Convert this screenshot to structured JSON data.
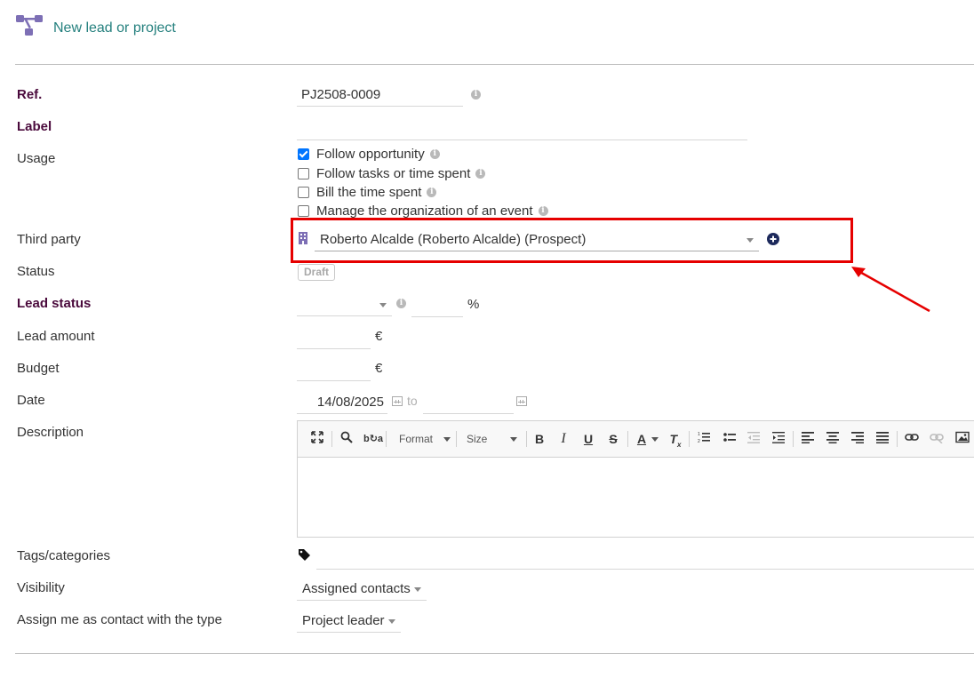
{
  "header": {
    "title": "New lead or project",
    "icon": "project-tree-icon"
  },
  "form": {
    "ref": {
      "label": "Ref.",
      "value": "PJ2508-0009"
    },
    "label_field": {
      "label": "Label",
      "value": ""
    },
    "usage": {
      "label": "Usage",
      "options": [
        {
          "label": "Follow opportunity",
          "checked": true
        },
        {
          "label": "Follow tasks or time spent",
          "checked": false
        },
        {
          "label": "Bill the time spent",
          "checked": false
        },
        {
          "label": "Manage the organization of an event",
          "checked": false
        }
      ]
    },
    "third_party": {
      "label": "Third party",
      "value": "Roberto Alcalde (Roberto Alcalde) (Prospect)"
    },
    "status": {
      "label": "Status",
      "value": "Draft"
    },
    "lead_status": {
      "label": "Lead status",
      "value": "",
      "percent_unit": "%"
    },
    "lead_amount": {
      "label": "Lead amount",
      "value": "",
      "currency": "€"
    },
    "budget": {
      "label": "Budget",
      "value": "",
      "currency": "€"
    },
    "date": {
      "label": "Date",
      "start": "14/08/2025",
      "to_label": "to",
      "end": ""
    },
    "description": {
      "label": "Description",
      "toolbar": {
        "format_label": "Format",
        "size_label": "Size"
      },
      "value": ""
    },
    "tags": {
      "label": "Tags/categories"
    },
    "visibility": {
      "label": "Visibility",
      "value": "Assigned contacts"
    },
    "assign_contact": {
      "label": "Assign me as contact with the type",
      "value": "Project leader"
    }
  },
  "colors": {
    "accent": "#25807e",
    "required_label": "#4a0a3c",
    "highlight": "#e60000"
  }
}
